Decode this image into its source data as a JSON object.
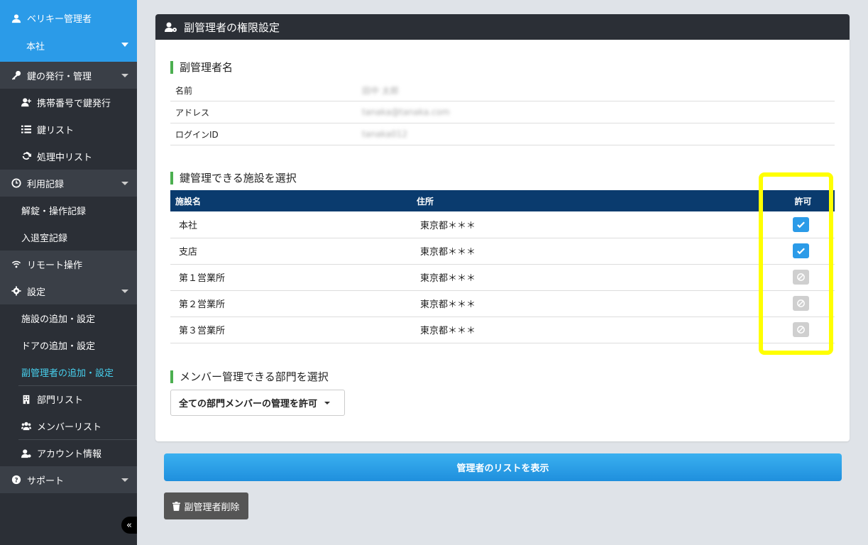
{
  "sidebar": {
    "user_name": "ベリキー管理者",
    "org": "本社",
    "sections": [
      {
        "label": "鍵の発行・管理"
      },
      {
        "label": "携帯番号で鍵発行"
      },
      {
        "label": "鍵リスト"
      },
      {
        "label": "処理中リスト"
      },
      {
        "label": "利用記録"
      },
      {
        "label": "解錠・操作記録"
      },
      {
        "label": "入退室記録"
      },
      {
        "label": "リモート操作"
      },
      {
        "label": "設定"
      },
      {
        "label": "施設の追加・設定"
      },
      {
        "label": "ドアの追加・設定"
      },
      {
        "label": "副管理者の追加・設定"
      },
      {
        "label": "部門リスト"
      },
      {
        "label": "メンバーリスト"
      },
      {
        "label": "アカウント情報"
      },
      {
        "label": "サポート"
      }
    ],
    "collapse_label": "«"
  },
  "panel": {
    "title": "副管理者の権限設定",
    "name_section": "副管理者名",
    "info": [
      {
        "label": "名前",
        "value": "田中 太郎"
      },
      {
        "label": "アドレス",
        "value": "tanaka@tanaka.com"
      },
      {
        "label": "ログインID",
        "value": "tanaka012"
      }
    ],
    "facility_section": "鍵管理できる施設を選択",
    "table_headers": {
      "name": "施設名",
      "address": "住所",
      "permit": "許可"
    },
    "facilities": [
      {
        "name": "本社",
        "address": "東京都＊＊＊",
        "allowed": true
      },
      {
        "name": "支店",
        "address": "東京都＊＊＊",
        "allowed": true
      },
      {
        "name": "第１営業所",
        "address": "東京都＊＊＊",
        "allowed": false
      },
      {
        "name": "第２営業所",
        "address": "東京都＊＊＊",
        "allowed": false
      },
      {
        "name": "第３営業所",
        "address": "東京都＊＊＊",
        "allowed": false
      }
    ],
    "member_section": "メンバー管理できる部門を選択",
    "dept_dropdown": "全ての部門メンバーの管理を許可"
  },
  "buttons": {
    "show_list": "管理者のリストを表示",
    "delete": "副管理者削除"
  },
  "colors": {
    "accent": "#2b9be8",
    "highlight": "#ffff00",
    "table_header": "#0a3b6e"
  }
}
